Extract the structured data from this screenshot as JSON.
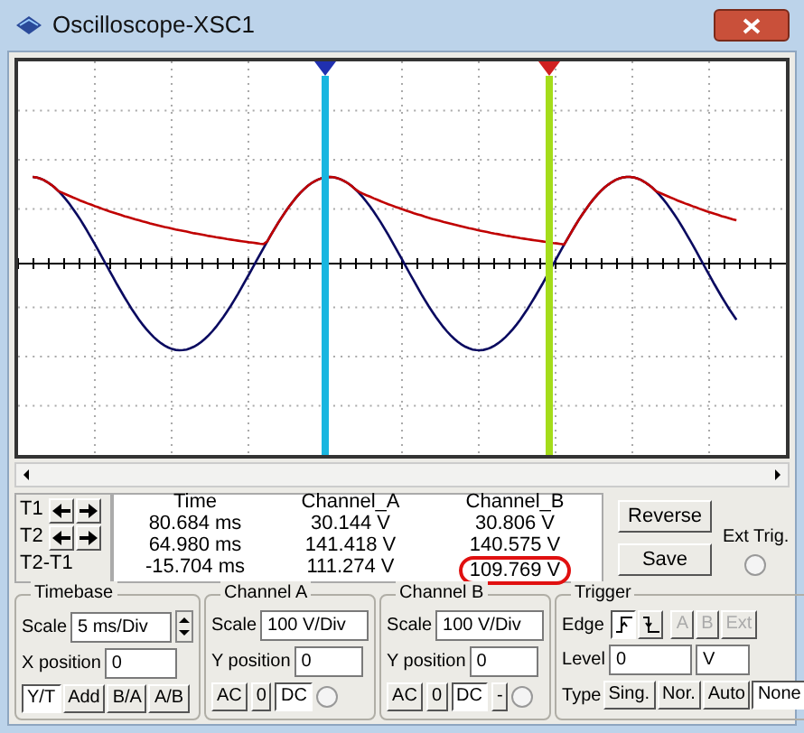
{
  "window": {
    "title": "Oscilloscope-XSC1"
  },
  "cursors": [
    {
      "color": "#19b6e0"
    },
    {
      "color": "#a4dc1a"
    }
  ],
  "readout": {
    "columns": [
      "Time",
      "Channel_A",
      "Channel_B"
    ],
    "rows": [
      {
        "label": "T1",
        "cells": [
          {
            "text": "80.684 ms",
            "circled": false
          },
          {
            "text": "30.144 V",
            "circled": false
          },
          {
            "text": "30.806 V",
            "circled": false
          }
        ]
      },
      {
        "label": "T2",
        "cells": [
          {
            "text": "64.980 ms",
            "circled": false
          },
          {
            "text": "141.418 V",
            "circled": false
          },
          {
            "text": "140.575 V",
            "circled": false
          }
        ]
      },
      {
        "label": "T2-T1",
        "cells": [
          {
            "text": "-15.704 ms",
            "circled": false
          },
          {
            "text": "111.274 V",
            "circled": false
          },
          {
            "text": "109.769 V",
            "circled": true
          }
        ]
      }
    ]
  },
  "buttons": [
    "Reverse",
    "Save"
  ],
  "ext_trig": {
    "label": "Ext Trig.",
    "checked": false
  },
  "timebase": {
    "title": "Timebase",
    "scale_label": "Scale",
    "scale": "5 ms/Div",
    "xpos_label": "X position",
    "xpos": "0",
    "modes": [
      {
        "label": "Y/T",
        "selected": true
      },
      {
        "label": "Add",
        "selected": false
      },
      {
        "label": "B/A",
        "selected": false
      },
      {
        "label": "A/B",
        "selected": false
      }
    ]
  },
  "channels": [
    {
      "title": "Channel A",
      "scale_label": "Scale",
      "scale": "100  V/Div",
      "ypos_label": "Y position",
      "ypos": "0",
      "coupling": [
        {
          "label": "AC",
          "selected": false
        },
        {
          "label": "0",
          "selected": false
        },
        {
          "label": "DC",
          "selected": true
        }
      ],
      "radio_checked": false
    },
    {
      "title": "Channel B",
      "scale_label": "Scale",
      "scale": "100  V/Div",
      "ypos_label": "Y position",
      "ypos": "0",
      "coupling": [
        {
          "label": "AC",
          "selected": false
        },
        {
          "label": "0",
          "selected": false
        },
        {
          "label": "DC",
          "selected": true
        },
        {
          "label": "-",
          "selected": false
        }
      ],
      "radio_checked": false
    }
  ],
  "trigger": {
    "title": "Trigger",
    "edge_label": "Edge",
    "edges": [
      {
        "kind": "rising",
        "selected": true
      },
      {
        "kind": "falling",
        "selected": false
      }
    ],
    "sources": [
      {
        "label": "A",
        "disabled": true
      },
      {
        "label": "B",
        "disabled": true
      },
      {
        "label": "Ext",
        "disabled": true
      }
    ],
    "level_label": "Level",
    "level": "0",
    "unit": "V",
    "type_label": "Type",
    "types": [
      {
        "label": "Sing.",
        "selected": false
      },
      {
        "label": "Nor.",
        "selected": false
      },
      {
        "label": "Auto",
        "selected": false
      },
      {
        "label": "None",
        "selected": true
      }
    ]
  }
}
